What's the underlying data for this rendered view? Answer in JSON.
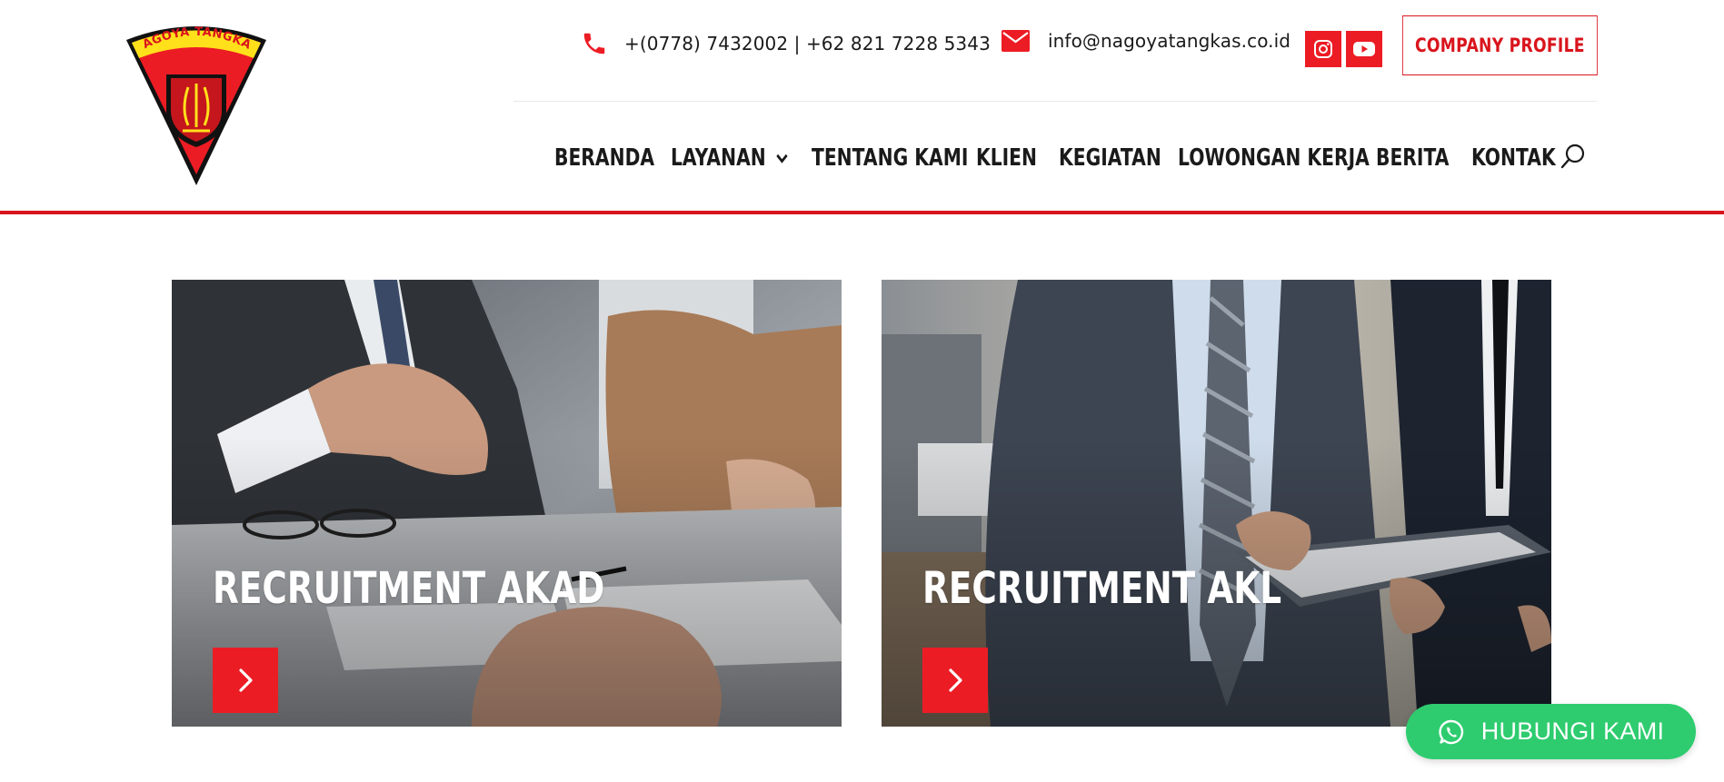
{
  "header": {
    "logo_text": "NAGOYA TANGKAS",
    "phone": "+(0778) 7432002 | +62 821 7228 5343",
    "email": "info@nagoyatangkas.co.id",
    "social": [
      {
        "name": "instagram-icon"
      },
      {
        "name": "youtube-icon"
      }
    ],
    "company_profile_label": "COMPANY PROFILE",
    "accent_color": "#d9141c"
  },
  "nav": {
    "items": [
      {
        "label": "BERANDA"
      },
      {
        "label": "LAYANAN",
        "has_dropdown": true
      },
      {
        "label": "TENTANG KAMI"
      },
      {
        "label": "KLIEN"
      },
      {
        "label": "KEGIATAN"
      },
      {
        "label": "LOWONGAN KERJA"
      },
      {
        "label": "BERITA"
      },
      {
        "label": "KONTAK"
      }
    ],
    "search_icon": "search-icon"
  },
  "cards": [
    {
      "title": "RECRUITMENT AKAD",
      "arrow_icon": "chevron-right-icon"
    },
    {
      "title": "RECRUITMENT AKL",
      "arrow_icon": "chevron-right-icon"
    }
  ],
  "whatsapp": {
    "label": "HUBUNGI KAMI",
    "color": "#2ecc6f"
  }
}
